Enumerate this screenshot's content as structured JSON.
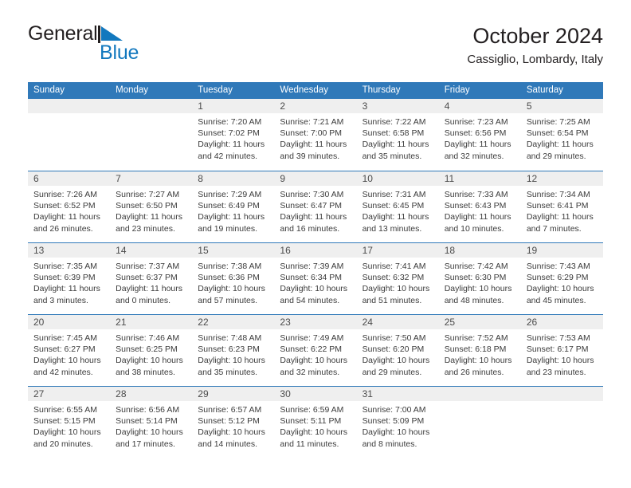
{
  "brand": {
    "name_part1": "General",
    "name_part2": "Blue",
    "mark_icon": "triangle-flag-icon"
  },
  "header": {
    "title": "October 2024",
    "location": "Cassiglio, Lombardy, Italy"
  },
  "colors": {
    "header_blue": "#3079b9",
    "brand_blue": "#1278be",
    "day_band_gray": "#efefef",
    "text": "#231f20"
  },
  "weekdays": [
    "Sunday",
    "Monday",
    "Tuesday",
    "Wednesday",
    "Thursday",
    "Friday",
    "Saturday"
  ],
  "weeks": [
    [
      {
        "day": "",
        "empty": true
      },
      {
        "day": "",
        "empty": true
      },
      {
        "day": "1",
        "sunrise": "Sunrise: 7:20 AM",
        "sunset": "Sunset: 7:02 PM",
        "daylight1": "Daylight: 11 hours",
        "daylight2": "and 42 minutes."
      },
      {
        "day": "2",
        "sunrise": "Sunrise: 7:21 AM",
        "sunset": "Sunset: 7:00 PM",
        "daylight1": "Daylight: 11 hours",
        "daylight2": "and 39 minutes."
      },
      {
        "day": "3",
        "sunrise": "Sunrise: 7:22 AM",
        "sunset": "Sunset: 6:58 PM",
        "daylight1": "Daylight: 11 hours",
        "daylight2": "and 35 minutes."
      },
      {
        "day": "4",
        "sunrise": "Sunrise: 7:23 AM",
        "sunset": "Sunset: 6:56 PM",
        "daylight1": "Daylight: 11 hours",
        "daylight2": "and 32 minutes."
      },
      {
        "day": "5",
        "sunrise": "Sunrise: 7:25 AM",
        "sunset": "Sunset: 6:54 PM",
        "daylight1": "Daylight: 11 hours",
        "daylight2": "and 29 minutes."
      }
    ],
    [
      {
        "day": "6",
        "sunrise": "Sunrise: 7:26 AM",
        "sunset": "Sunset: 6:52 PM",
        "daylight1": "Daylight: 11 hours",
        "daylight2": "and 26 minutes."
      },
      {
        "day": "7",
        "sunrise": "Sunrise: 7:27 AM",
        "sunset": "Sunset: 6:50 PM",
        "daylight1": "Daylight: 11 hours",
        "daylight2": "and 23 minutes."
      },
      {
        "day": "8",
        "sunrise": "Sunrise: 7:29 AM",
        "sunset": "Sunset: 6:49 PM",
        "daylight1": "Daylight: 11 hours",
        "daylight2": "and 19 minutes."
      },
      {
        "day": "9",
        "sunrise": "Sunrise: 7:30 AM",
        "sunset": "Sunset: 6:47 PM",
        "daylight1": "Daylight: 11 hours",
        "daylight2": "and 16 minutes."
      },
      {
        "day": "10",
        "sunrise": "Sunrise: 7:31 AM",
        "sunset": "Sunset: 6:45 PM",
        "daylight1": "Daylight: 11 hours",
        "daylight2": "and 13 minutes."
      },
      {
        "day": "11",
        "sunrise": "Sunrise: 7:33 AM",
        "sunset": "Sunset: 6:43 PM",
        "daylight1": "Daylight: 11 hours",
        "daylight2": "and 10 minutes."
      },
      {
        "day": "12",
        "sunrise": "Sunrise: 7:34 AM",
        "sunset": "Sunset: 6:41 PM",
        "daylight1": "Daylight: 11 hours",
        "daylight2": "and 7 minutes."
      }
    ],
    [
      {
        "day": "13",
        "sunrise": "Sunrise: 7:35 AM",
        "sunset": "Sunset: 6:39 PM",
        "daylight1": "Daylight: 11 hours",
        "daylight2": "and 3 minutes."
      },
      {
        "day": "14",
        "sunrise": "Sunrise: 7:37 AM",
        "sunset": "Sunset: 6:37 PM",
        "daylight1": "Daylight: 11 hours",
        "daylight2": "and 0 minutes."
      },
      {
        "day": "15",
        "sunrise": "Sunrise: 7:38 AM",
        "sunset": "Sunset: 6:36 PM",
        "daylight1": "Daylight: 10 hours",
        "daylight2": "and 57 minutes."
      },
      {
        "day": "16",
        "sunrise": "Sunrise: 7:39 AM",
        "sunset": "Sunset: 6:34 PM",
        "daylight1": "Daylight: 10 hours",
        "daylight2": "and 54 minutes."
      },
      {
        "day": "17",
        "sunrise": "Sunrise: 7:41 AM",
        "sunset": "Sunset: 6:32 PM",
        "daylight1": "Daylight: 10 hours",
        "daylight2": "and 51 minutes."
      },
      {
        "day": "18",
        "sunrise": "Sunrise: 7:42 AM",
        "sunset": "Sunset: 6:30 PM",
        "daylight1": "Daylight: 10 hours",
        "daylight2": "and 48 minutes."
      },
      {
        "day": "19",
        "sunrise": "Sunrise: 7:43 AM",
        "sunset": "Sunset: 6:29 PM",
        "daylight1": "Daylight: 10 hours",
        "daylight2": "and 45 minutes."
      }
    ],
    [
      {
        "day": "20",
        "sunrise": "Sunrise: 7:45 AM",
        "sunset": "Sunset: 6:27 PM",
        "daylight1": "Daylight: 10 hours",
        "daylight2": "and 42 minutes."
      },
      {
        "day": "21",
        "sunrise": "Sunrise: 7:46 AM",
        "sunset": "Sunset: 6:25 PM",
        "daylight1": "Daylight: 10 hours",
        "daylight2": "and 38 minutes."
      },
      {
        "day": "22",
        "sunrise": "Sunrise: 7:48 AM",
        "sunset": "Sunset: 6:23 PM",
        "daylight1": "Daylight: 10 hours",
        "daylight2": "and 35 minutes."
      },
      {
        "day": "23",
        "sunrise": "Sunrise: 7:49 AM",
        "sunset": "Sunset: 6:22 PM",
        "daylight1": "Daylight: 10 hours",
        "daylight2": "and 32 minutes."
      },
      {
        "day": "24",
        "sunrise": "Sunrise: 7:50 AM",
        "sunset": "Sunset: 6:20 PM",
        "daylight1": "Daylight: 10 hours",
        "daylight2": "and 29 minutes."
      },
      {
        "day": "25",
        "sunrise": "Sunrise: 7:52 AM",
        "sunset": "Sunset: 6:18 PM",
        "daylight1": "Daylight: 10 hours",
        "daylight2": "and 26 minutes."
      },
      {
        "day": "26",
        "sunrise": "Sunrise: 7:53 AM",
        "sunset": "Sunset: 6:17 PM",
        "daylight1": "Daylight: 10 hours",
        "daylight2": "and 23 minutes."
      }
    ],
    [
      {
        "day": "27",
        "sunrise": "Sunrise: 6:55 AM",
        "sunset": "Sunset: 5:15 PM",
        "daylight1": "Daylight: 10 hours",
        "daylight2": "and 20 minutes."
      },
      {
        "day": "28",
        "sunrise": "Sunrise: 6:56 AM",
        "sunset": "Sunset: 5:14 PM",
        "daylight1": "Daylight: 10 hours",
        "daylight2": "and 17 minutes."
      },
      {
        "day": "29",
        "sunrise": "Sunrise: 6:57 AM",
        "sunset": "Sunset: 5:12 PM",
        "daylight1": "Daylight: 10 hours",
        "daylight2": "and 14 minutes."
      },
      {
        "day": "30",
        "sunrise": "Sunrise: 6:59 AM",
        "sunset": "Sunset: 5:11 PM",
        "daylight1": "Daylight: 10 hours",
        "daylight2": "and 11 minutes."
      },
      {
        "day": "31",
        "sunrise": "Sunrise: 7:00 AM",
        "sunset": "Sunset: 5:09 PM",
        "daylight1": "Daylight: 10 hours",
        "daylight2": "and 8 minutes."
      },
      {
        "day": "",
        "empty": true
      },
      {
        "day": "",
        "empty": true
      }
    ]
  ]
}
